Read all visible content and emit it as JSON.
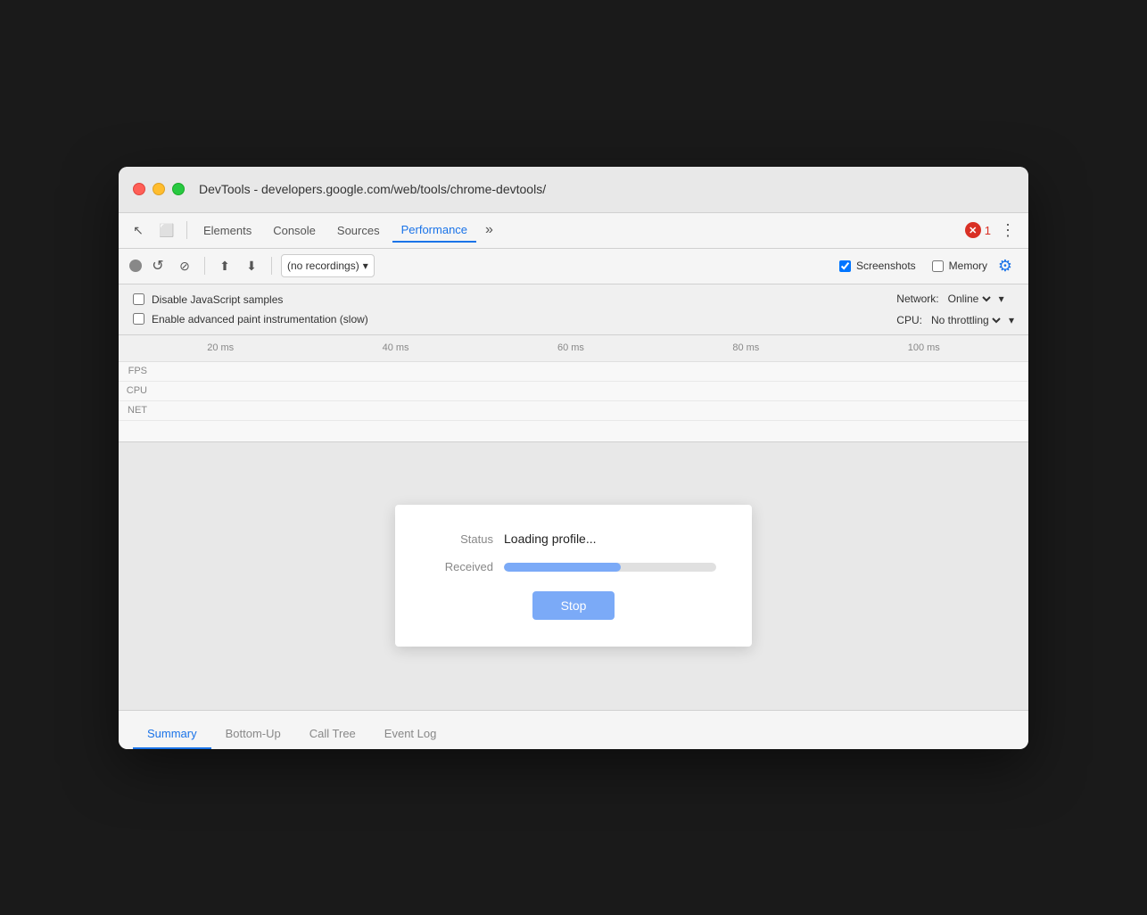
{
  "window": {
    "title": "DevTools - developers.google.com/web/tools/chrome-devtools/"
  },
  "tabs": {
    "items": [
      {
        "label": "Elements",
        "active": false
      },
      {
        "label": "Console",
        "active": false
      },
      {
        "label": "Sources",
        "active": false
      },
      {
        "label": "Performance",
        "active": true
      }
    ],
    "more_label": "»",
    "error_count": "1",
    "dots_label": "⋮"
  },
  "toolbar": {
    "record_title": "Record",
    "reload_title": "Reload and record",
    "clear_title": "Clear recording",
    "upload_title": "Load profile",
    "download_title": "Save profile",
    "dropdown_value": "(no recordings)",
    "screenshots_label": "Screenshots",
    "memory_label": "Memory",
    "gear_title": "Capture settings"
  },
  "settings": {
    "js_samples_label": "Disable JavaScript samples",
    "paint_label": "Enable advanced paint instrumentation (slow)",
    "network_label": "Network:",
    "network_value": "Online",
    "cpu_label": "CPU:",
    "cpu_value": "No throttling"
  },
  "timeline": {
    "ruler_marks": [
      "20 ms",
      "40 ms",
      "60 ms",
      "80 ms",
      "100 ms"
    ],
    "row_labels": [
      "FPS",
      "CPU",
      "NET"
    ]
  },
  "dialog": {
    "status_label": "Status",
    "status_value": "Loading profile...",
    "received_label": "Received",
    "progress_percent": 55,
    "stop_label": "Stop"
  },
  "bottom_tabs": {
    "items": [
      {
        "label": "Summary",
        "active": true
      },
      {
        "label": "Bottom-Up",
        "active": false
      },
      {
        "label": "Call Tree",
        "active": false
      },
      {
        "label": "Event Log",
        "active": false
      }
    ]
  },
  "icons": {
    "cursor": "↖",
    "device": "⬜",
    "record": "●",
    "reload": "↺",
    "block": "⊘",
    "upload": "⬆",
    "download": "⬇",
    "dropdown_arrow": "▾",
    "checkbox_checked": "✓",
    "gear": "⚙"
  }
}
